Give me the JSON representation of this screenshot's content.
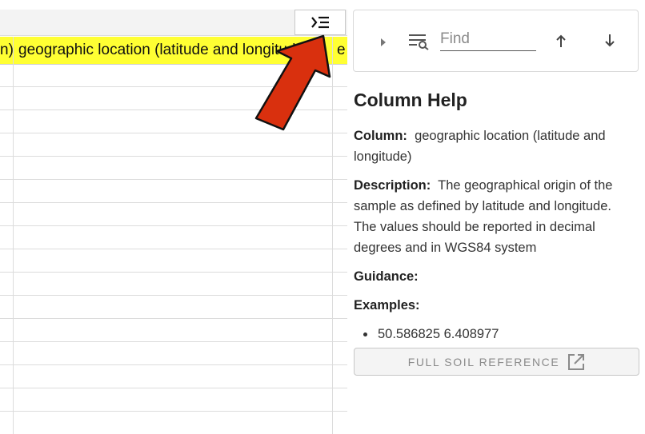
{
  "sheet": {
    "header_cells": {
      "left_partial": "n)",
      "main": "geographic location (latitude and longitude)",
      "right_partial": "e"
    }
  },
  "panel": {
    "find": {
      "placeholder": "Find",
      "value": ""
    },
    "title": "Column Help",
    "column_label": "Column:",
    "column_value": "geographic location (latitude and longitude)",
    "description_label": "Description:",
    "description_value": "The geographical origin of the sample as defined by latitude and longitude. The values should be reported in decimal degrees and in WGS84 system",
    "guidance_label": "Guidance:",
    "examples_label": "Examples:",
    "examples": [
      "50.586825 6.408977"
    ],
    "reference_button": "FULL SOIL REFERENCE"
  },
  "icons": {
    "toggle": "collapse-panel-icon",
    "expand": "play-arrow-icon",
    "filter": "filter-search-icon",
    "up": "arrow-up-icon",
    "down": "arrow-down-icon",
    "external": "open-in-new-icon"
  },
  "colors": {
    "header_highlight": "#ffff33",
    "annotation_arrow": "#d9300e"
  }
}
